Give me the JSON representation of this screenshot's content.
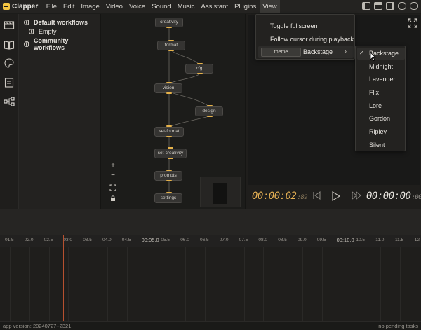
{
  "app": {
    "name": "Clapper"
  },
  "menubar": {
    "items": [
      "File",
      "Edit",
      "Image",
      "Video",
      "Voice",
      "Sound",
      "Music",
      "Assistant",
      "Plugins",
      "View"
    ],
    "active": "View"
  },
  "rail": {
    "icons": [
      "film-icon",
      "book-icon",
      "palette-icon",
      "script-icon",
      "workflow-icon"
    ]
  },
  "workflows": {
    "default_label": "Default workflows",
    "empty_label": "Empty",
    "community_label": "Community workflows"
  },
  "flow": {
    "nodes": [
      "creativity",
      "format",
      "cfg",
      "vision",
      "design",
      "set-format",
      "set-creativity",
      "prompts",
      "settings"
    ],
    "zoom_in": "+",
    "zoom_out": "−"
  },
  "player": {
    "current_time": "00:00:02",
    "current_frames": ":89",
    "total_time": "00:00:00",
    "total_frames": ":00"
  },
  "timeline": {
    "ticks": [
      "01.5",
      "02.0",
      "02.5",
      "03.0",
      "03.5",
      "04.0",
      "04.5",
      "00:05.0",
      "05.5",
      "06.0",
      "06.5",
      "07.0",
      "07.5",
      "08.0",
      "08.5",
      "09.0",
      "09.5",
      "00:10.0",
      "10.5",
      "11.0",
      "11.5",
      "12"
    ]
  },
  "footer": {
    "version": "app version: 20240727+2321",
    "tasks": "no pending tasks"
  },
  "view_menu": {
    "items": [
      "Toggle fullscreen",
      "Follow cursor during playback"
    ],
    "theme_label": "theme",
    "theme_value": "Backstage",
    "chevron": "›"
  },
  "theme_submenu": {
    "selected": "Backstage",
    "check": "✓",
    "items": [
      "Backstage",
      "Midnight",
      "Lavender",
      "Flix",
      "Lore",
      "Gordon",
      "Ripley",
      "Silent"
    ]
  },
  "colors": {
    "accent": "#e8b254",
    "playhead": "#b6502f"
  }
}
